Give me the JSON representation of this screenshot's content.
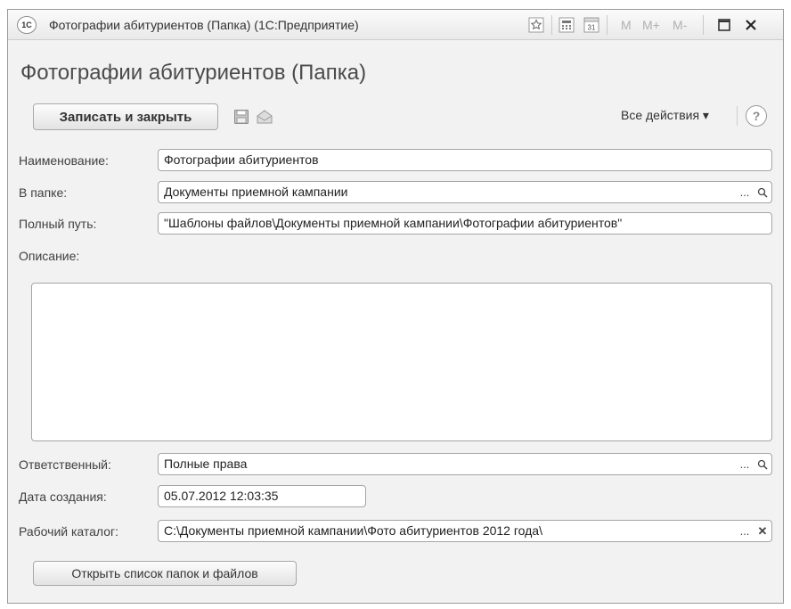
{
  "window": {
    "title": "Фотографии абитуриентов (Папка)  (1С:Предприятие)",
    "logo_text": "1С",
    "toolbar_m_labels": [
      "M",
      "M+",
      "M-"
    ]
  },
  "form": {
    "title": "Фотографии абитуриентов (Папка)",
    "save_close_label": "Записать и закрыть",
    "all_actions_label": "Все действия ▾",
    "help_label": "?"
  },
  "fields": {
    "name": {
      "label": "Наименование:",
      "value": "Фотографии абитуриентов"
    },
    "folder": {
      "label": "В папке:",
      "value": "Документы приемной кампании"
    },
    "full_path": {
      "label": "Полный путь:",
      "value": "\"Шаблоны файлов\\Документы приемной кампании\\Фотографии абитуриентов\""
    },
    "description": {
      "label": "Описание:",
      "value": ""
    },
    "responsible": {
      "label": "Ответственный:",
      "value": "Полные права"
    },
    "created": {
      "label": "Дата создания:",
      "value": "05.07.2012 12:03:35"
    },
    "workdir": {
      "label": "Рабочий каталог:",
      "value": "C:\\Документы приемной кампании\\Фото абитуриентов 2012 года\\"
    }
  },
  "buttons": {
    "open_list_label": "Открыть список папок и файлов",
    "ellipsis": "...",
    "clear": "✕",
    "search": "⌕"
  },
  "icons": {
    "favorite": "star-icon",
    "calculator": "calculator-icon",
    "calendar": "calendar-icon",
    "maximize": "maximize-icon",
    "close": "close-icon",
    "save": "floppy-disk-icon",
    "mail": "envelope-icon"
  }
}
